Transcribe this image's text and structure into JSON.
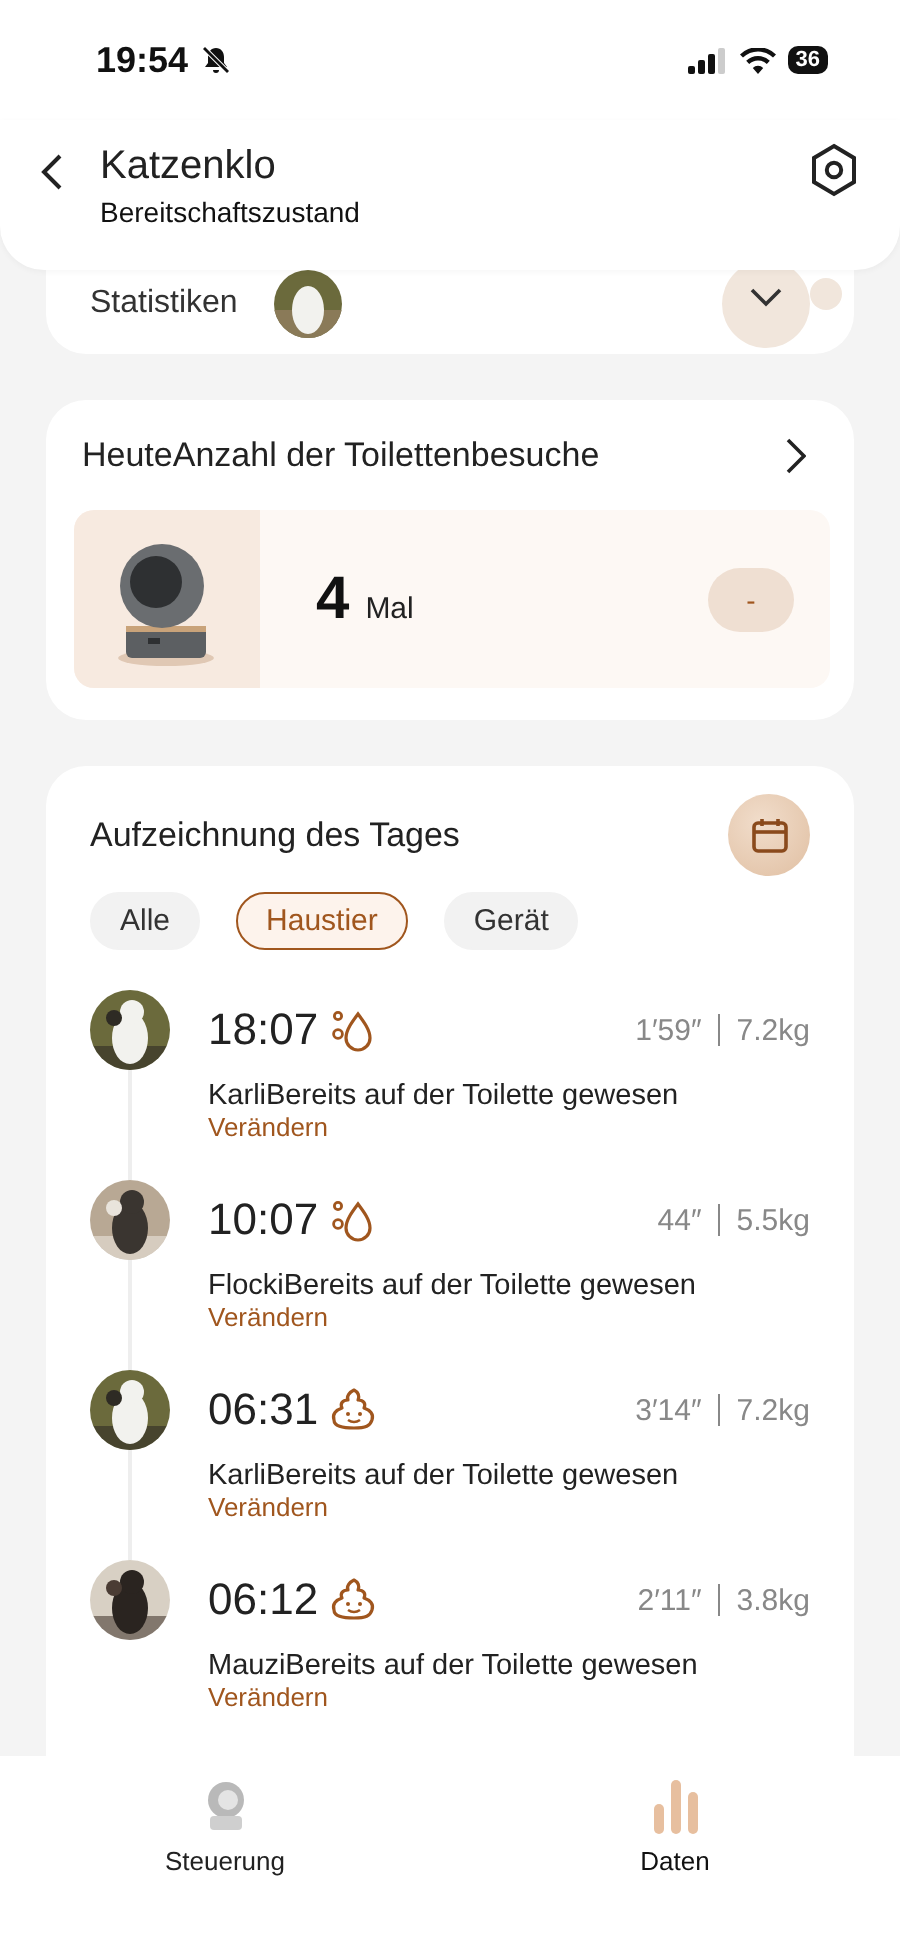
{
  "status_bar": {
    "time": "19:54",
    "battery": "36"
  },
  "header": {
    "title": "Katzenklo",
    "subtitle": "Bereitschaftszustand"
  },
  "statistics": {
    "label": "Statistiken"
  },
  "today": {
    "title": "HeuteAnzahl der Toilettenbesuche",
    "count": "4",
    "unit": "Mal",
    "action": "-"
  },
  "records": {
    "title": "Aufzeichnung des Tages",
    "filters": [
      {
        "label": "Alle",
        "selected": false
      },
      {
        "label": "Haustier",
        "selected": true
      },
      {
        "label": "Gerät",
        "selected": false
      }
    ],
    "items": [
      {
        "time": "18:07",
        "kind": "urine",
        "duration": "1′59″",
        "weight": "7.2kg",
        "text": "KarliBereits auf der Toilette gewesen",
        "link": "Verändern"
      },
      {
        "time": "10:07",
        "kind": "urine",
        "duration": "44″",
        "weight": "5.5kg",
        "text": "FlockiBereits auf der Toilette gewesen",
        "link": "Verändern"
      },
      {
        "time": "06:31",
        "kind": "stool",
        "duration": "3′14″",
        "weight": "7.2kg",
        "text": "KarliBereits auf der Toilette gewesen",
        "link": "Verändern"
      },
      {
        "time": "06:12",
        "kind": "stool",
        "duration": "2′11″",
        "weight": "3.8kg",
        "text": "MauziBereits auf der Toilette gewesen",
        "link": "Verändern"
      }
    ]
  },
  "tab_bar": [
    {
      "label": "Steuerung",
      "selected": false
    },
    {
      "label": "Daten",
      "selected": true
    }
  ]
}
